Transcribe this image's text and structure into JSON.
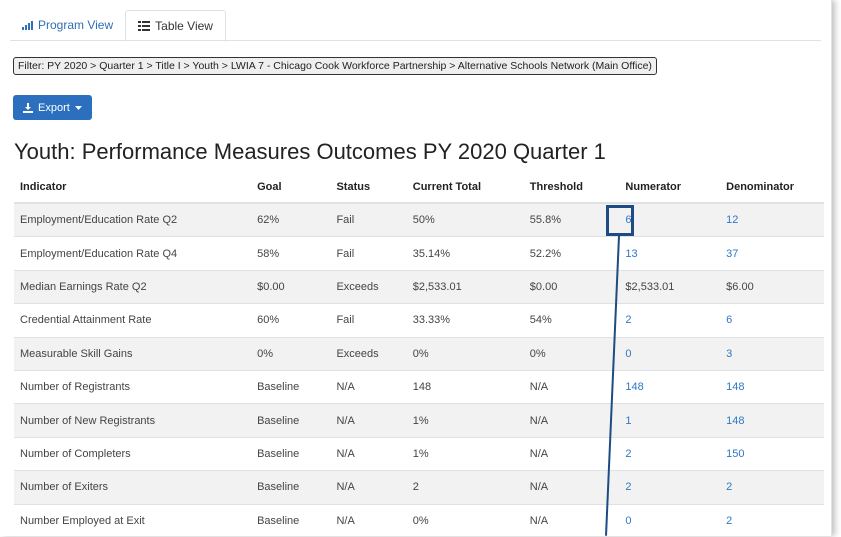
{
  "tabs": [
    {
      "label": "Program View",
      "icon": "bar-chart-icon"
    },
    {
      "label": "Table View",
      "icon": "list-icon"
    }
  ],
  "filter": "Filter: PY 2020 > Quarter 1 > Title I > Youth > LWIA 7 - Chicago Cook Workforce Partnership > Alternative Schools Network (Main Office)",
  "export_label": "Export",
  "page_title": "Youth: Performance Measures Outcomes PY 2020 Quarter 1",
  "table": {
    "headers": [
      "Indicator",
      "Goal",
      "Status",
      "Current Total",
      "Threshold",
      "Numerator",
      "Denominator"
    ],
    "rows": [
      [
        "Employment/Education Rate Q2",
        "62%",
        "Fail",
        "50%",
        "55.8%",
        "6",
        "12"
      ],
      [
        "Employment/Education Rate Q4",
        "58%",
        "Fail",
        "35.14%",
        "52.2%",
        "13",
        "37"
      ],
      [
        "Median Earnings Rate Q2",
        "$0.00",
        "Exceeds",
        "$2,533.01",
        "$0.00",
        "$2,533.01",
        "$6.00"
      ],
      [
        "Credential Attainment Rate",
        "60%",
        "Fail",
        "33.33%",
        "54%",
        "2",
        "6"
      ],
      [
        "Measurable Skill Gains",
        "0%",
        "Exceeds",
        "0%",
        "0%",
        "0",
        "3"
      ],
      [
        "Number of Registrants",
        "Baseline",
        "N/A",
        "148",
        "N/A",
        "148",
        "148"
      ],
      [
        "Number of New Registrants",
        "Baseline",
        "N/A",
        "1%",
        "N/A",
        "1",
        "148"
      ],
      [
        "Number of Completers",
        "Baseline",
        "N/A",
        "1%",
        "N/A",
        "2",
        "150"
      ],
      [
        "Number of Exiters",
        "Baseline",
        "N/A",
        "2",
        "N/A",
        "2",
        "2"
      ],
      [
        "Number Employed at Exit",
        "Baseline",
        "N/A",
        "0%",
        "N/A",
        "0",
        "2"
      ]
    ]
  },
  "colors": {
    "accent": "#2c6fbf",
    "link": "#2f78c4",
    "highlight": "#1f4b84"
  }
}
